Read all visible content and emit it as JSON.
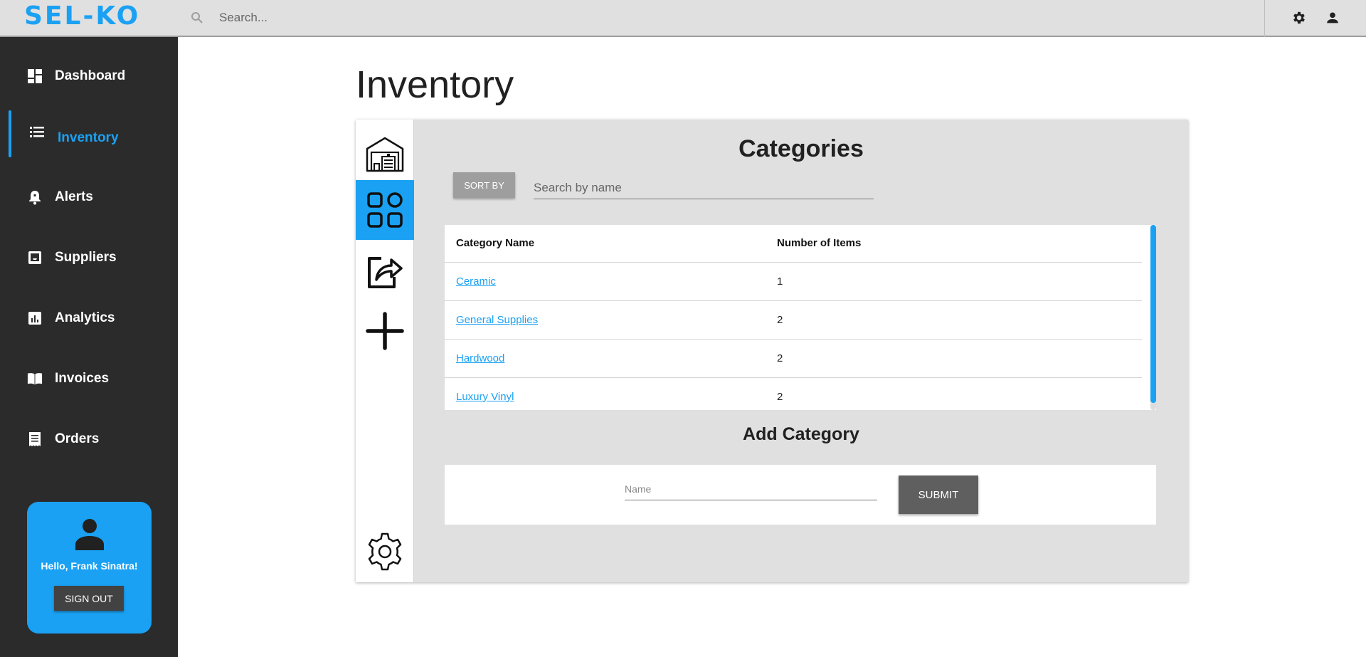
{
  "app": {
    "logo": "SEL-KO",
    "accent_color": "#1aa1f3"
  },
  "topbar": {
    "search_placeholder": "Search...",
    "icons": [
      "search-icon",
      "gear-icon",
      "person-icon"
    ]
  },
  "sidebar": {
    "items": [
      {
        "label": "Dashboard",
        "icon": "dashboard-icon",
        "active": false
      },
      {
        "label": "Inventory",
        "icon": "list-icon",
        "active": true
      },
      {
        "label": "Alerts",
        "icon": "bell-icon",
        "active": false
      },
      {
        "label": "Suppliers",
        "icon": "inbox-icon",
        "active": false
      },
      {
        "label": "Analytics",
        "icon": "chart-icon",
        "active": false
      },
      {
        "label": "Invoices",
        "icon": "book-icon",
        "active": false
      },
      {
        "label": "Orders",
        "icon": "receipt-icon",
        "active": false
      }
    ],
    "user": {
      "greeting": "Hello, Frank Sinatra!",
      "signout_label": "SIGN OUT"
    }
  },
  "main": {
    "page_title": "Inventory",
    "side_tabs": [
      {
        "icon": "warehouse-icon",
        "active": false
      },
      {
        "icon": "categories-grid-icon",
        "active": true
      },
      {
        "icon": "export-icon",
        "active": false
      },
      {
        "icon": "plus-icon",
        "active": false
      },
      {
        "icon": "settings-gear-icon",
        "active": false
      }
    ],
    "categories": {
      "title": "Categories",
      "sort_label": "SORT BY",
      "search_placeholder": "Search by name",
      "columns": [
        "Category Name",
        "Number of Items"
      ],
      "rows": [
        {
          "name": "Ceramic",
          "count": "1"
        },
        {
          "name": "General Supplies",
          "count": "2"
        },
        {
          "name": "Hardwood",
          "count": "2"
        },
        {
          "name": "Luxury Vinyl",
          "count": "2"
        }
      ]
    },
    "add_category": {
      "title": "Add Category",
      "name_placeholder": "Name",
      "submit_label": "SUBMIT"
    }
  }
}
